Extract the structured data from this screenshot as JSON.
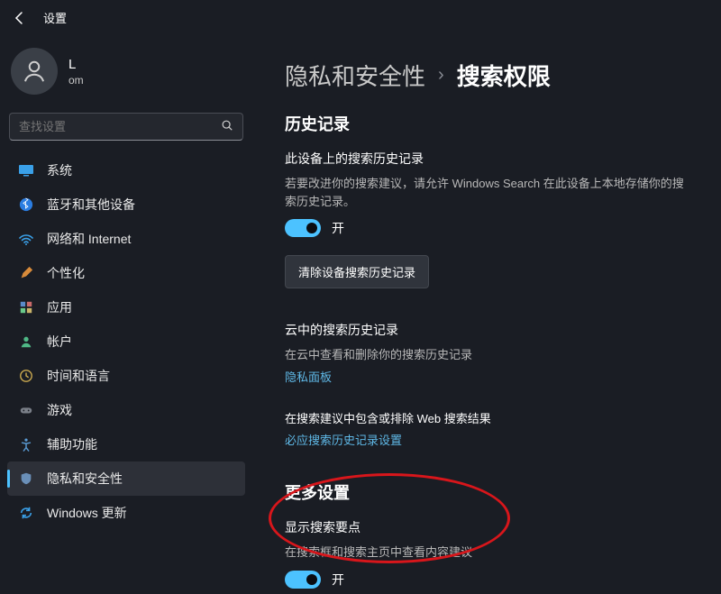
{
  "titlebar": {
    "label": "设置"
  },
  "profile": {
    "name": "L",
    "email": "om"
  },
  "search": {
    "placeholder": "查找设置"
  },
  "nav": {
    "items": [
      {
        "label": "系统"
      },
      {
        "label": "蓝牙和其他设备"
      },
      {
        "label": "网络和 Internet"
      },
      {
        "label": "个性化"
      },
      {
        "label": "应用"
      },
      {
        "label": "帐户"
      },
      {
        "label": "时间和语言"
      },
      {
        "label": "游戏"
      },
      {
        "label": "辅助功能"
      },
      {
        "label": "隐私和安全性"
      },
      {
        "label": "Windows 更新"
      }
    ]
  },
  "breadcrumb": {
    "parent": "隐私和安全性",
    "sep": "›",
    "current": "搜索权限"
  },
  "history": {
    "heading": "历史记录",
    "device": {
      "title": "此设备上的搜索历史记录",
      "desc": "若要改进你的搜索建议，请允许 Windows Search 在此设备上本地存储你的搜索历史记录。",
      "toggle_label": "开",
      "clear_button": "清除设备搜索历史记录"
    },
    "cloud": {
      "title": "云中的搜索历史记录",
      "desc": "在云中查看和删除你的搜索历史记录",
      "link": "隐私面板"
    },
    "web": {
      "desc": "在搜索建议中包含或排除 Web 搜索结果",
      "link": "必应搜索历史记录设置"
    }
  },
  "more": {
    "heading": "更多设置",
    "highlights": {
      "title": "显示搜索要点",
      "desc": "在搜索框和搜索主页中查看内容建议",
      "toggle_label": "开"
    }
  },
  "icons": {
    "system": "monitor",
    "bluetooth": "bluetooth",
    "network": "wifi",
    "personalize": "brush",
    "apps": "grid",
    "accounts": "person",
    "time": "clock",
    "gaming": "gamepad",
    "accessibility": "accessibility",
    "privacy": "shield",
    "update": "sync"
  },
  "colors": {
    "accent": "#4cc2ff",
    "annotation": "#d8161b"
  }
}
